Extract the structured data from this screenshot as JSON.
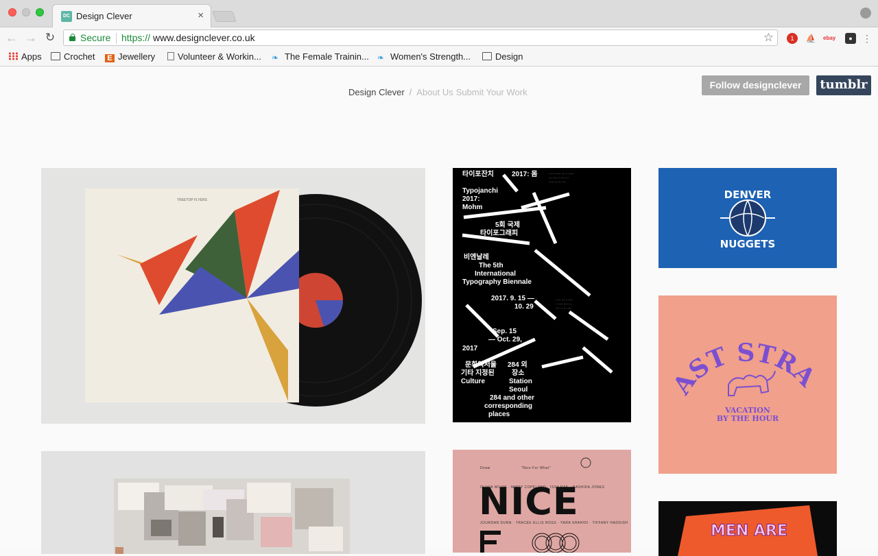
{
  "browser": {
    "tab_title": "Design Clever",
    "tab_favicon": "DC",
    "secure_label": "Secure",
    "url_scheme": "https://",
    "url_host": "www.designclever.co.uk",
    "bookmarks": [
      {
        "label": "Apps",
        "icon": "apps-grid-icon"
      },
      {
        "label": "Crochet",
        "icon": "folder-icon"
      },
      {
        "label": "Jewellery",
        "icon": "etsy-icon"
      },
      {
        "label": "Volunteer & Workin...",
        "icon": "page-icon"
      },
      {
        "label": "The Female Trainin...",
        "icon": "bird-icon"
      },
      {
        "label": "Women's Strength...",
        "icon": "bird-icon"
      },
      {
        "label": "Design",
        "icon": "folder-icon"
      }
    ],
    "extension_badge": "1",
    "ebay_label": "ebay"
  },
  "header": {
    "home": "Design Clever",
    "separator": "/",
    "about": "About Us",
    "submit": "Submit Your Work",
    "follow_button": "Follow designclever",
    "tumblr_button": "tumblr"
  },
  "posts": {
    "album": {
      "cover_title": "TREETOP FLYERS"
    },
    "poster": {
      "lines_top": [
        "타이포잔치",
        "2017: 몸"
      ],
      "title_en": [
        "Typojanchi",
        "2017:",
        "Mohm"
      ],
      "title_kr": [
        "5회 국제",
        "타이포그래피"
      ],
      "biennale_kr": "비엔날레",
      "biennale_en": [
        "The 5th",
        "International",
        "Typography Biennale"
      ],
      "dates_kr": [
        "2017. 9. 15 —",
        "10. 29"
      ],
      "dates_en": [
        "Sep. 15",
        "— Oct. 29,"
      ],
      "year": "2017",
      "venue_kr": [
        "문화역서울",
        "284 외",
        "기타 지정된",
        "장소"
      ],
      "venue_en": [
        "Culture",
        "Station",
        "Seoul",
        "284 and other",
        "corresponding",
        "places"
      ]
    },
    "nuggets": {
      "line1": "DENVER",
      "line2": "NUGGETS"
    },
    "last_straw": {
      "title": "LAST STRAW",
      "tagline": [
        "VACATION",
        "BY THE HOUR"
      ]
    },
    "nice": {
      "title": "NICE",
      "lead_label": "Dnaw",
      "lead_text": "\"Nice For What\"",
      "names_row1": "OLIVIA WILDE · MISTY COPELAND · ISSA RAE · RASHIDA JONES",
      "names_row2": "JOURDAN DUNN · TRACEE ELLIS ROSS · YARA SHAHIDI · TIFFANY HADDISH"
    },
    "men_are": {
      "text": "MEN ARE"
    }
  }
}
